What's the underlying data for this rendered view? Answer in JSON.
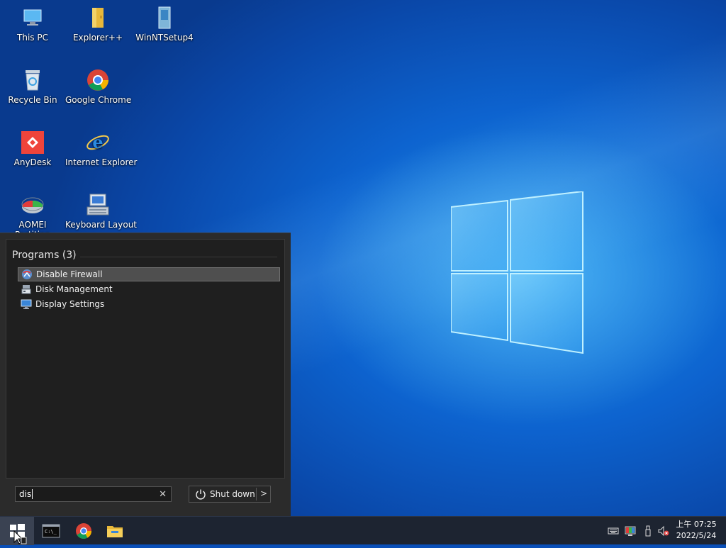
{
  "desktop": {
    "icons": [
      {
        "label": "This PC"
      },
      {
        "label": "Explorer++"
      },
      {
        "label": "WinNTSetup4"
      },
      {
        "label": "Recycle Bin"
      },
      {
        "label": "Google Chrome"
      },
      {
        "label": "AnyDesk"
      },
      {
        "label": "Internet Explorer"
      },
      {
        "label": "AOMEI Partition Assistant Stan"
      },
      {
        "label": "Keyboard Layout"
      }
    ]
  },
  "start_menu": {
    "section_title": "Programs (3)",
    "items": [
      {
        "label": "Disable Firewall",
        "icon": "firewall-icon",
        "selected": true
      },
      {
        "label": "Disk Management",
        "icon": "disk-management-icon",
        "selected": false
      },
      {
        "label": "Display Settings",
        "icon": "display-icon",
        "selected": false
      }
    ],
    "search": {
      "value": "dis"
    },
    "shutdown_label": "Shut down"
  },
  "taskbar": {
    "pinned": [
      "cmd-icon",
      "chrome-icon",
      "file-explorer-icon"
    ],
    "tray": [
      "keyboard-icon",
      "color-display-icon",
      "usb-icon",
      "volume-muted-icon"
    ],
    "clock": {
      "time": "07:25",
      "time_prefix": "上午",
      "date": "2022/5/24"
    }
  },
  "colors": {
    "accent": "#0a63cf",
    "menu_bg": "#1f1f1f",
    "taskbar_bg": "#1d2431"
  }
}
